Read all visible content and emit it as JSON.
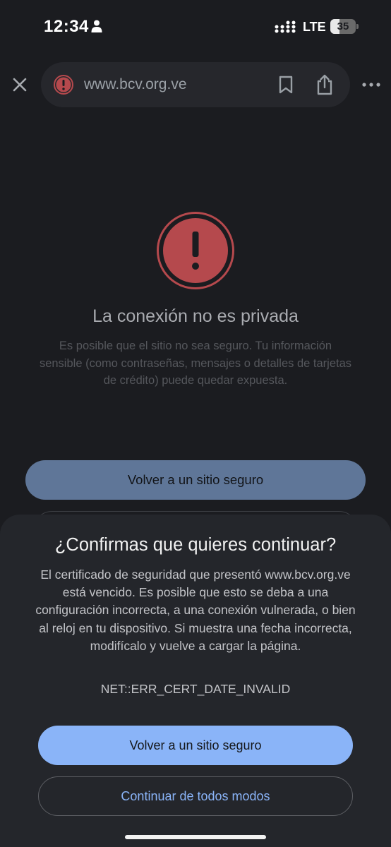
{
  "status_bar": {
    "time": "12:34",
    "network": "LTE",
    "battery_level": "35",
    "battery_fraction": 0.35
  },
  "toolbar": {
    "url": "www.bcv.org.ve",
    "icons": [
      "close-icon",
      "warning-icon",
      "bookmark-icon",
      "share-icon",
      "more-icon"
    ]
  },
  "error_page": {
    "title": "La conexión no es privada",
    "description": "Es posible que el sitio no sea seguro. Tu información sensible (como contraseñas, mensajes o detalles de tarjetas de crédito) puede quedar expuesta.",
    "primary_button": "Volver a un sitio seguro"
  },
  "dialog": {
    "title": "¿Confirmas que quieres continuar?",
    "description": "El certificado de seguridad que presentó www.bcv.org.ve está vencido. Es posible que esto se deba a una configuración incorrecta, a una conexión vulnerada, o bien al reloj en tu dispositivo. Si muestra una fecha incorrecta, modifícalo y vuelve a cargar la página.",
    "error_code": "NET::ERR_CERT_DATE_INVALID",
    "back_button": "Volver a un sitio seguro",
    "continue_button": "Continuar de todos modos"
  },
  "colors": {
    "background": "#1b1c20",
    "sheet": "#24262b",
    "accent": "#8ab4f8",
    "danger": "#b5494d"
  }
}
